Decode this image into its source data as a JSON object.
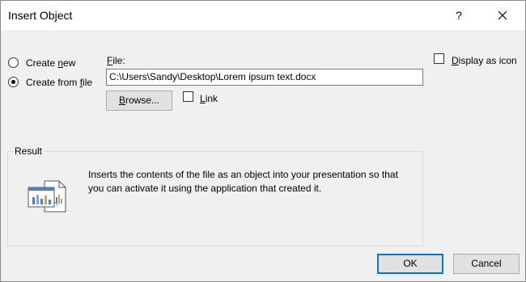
{
  "window": {
    "title": "Insert Object",
    "help_label": "?",
    "close_icon": "close-icon"
  },
  "options": {
    "create_new_prefix": "Create ",
    "create_new_underlined": "n",
    "create_new_suffix": "ew",
    "create_from_file_prefix": "Create from ",
    "create_from_file_underlined": "f",
    "create_from_file_suffix": "ile",
    "selected": "create_from_file"
  },
  "file": {
    "label_underlined": "F",
    "label_rest": "ile:",
    "value": "C:\\Users\\Sandy\\Desktop\\Lorem ipsum text.docx",
    "browse_underlined": "B",
    "browse_rest": "rowse...",
    "link_underlined": "L",
    "link_rest": "ink",
    "link_checked": false
  },
  "display_as_icon": {
    "underlined": "D",
    "rest": "isplay as icon",
    "checked": false
  },
  "result": {
    "legend": "Result",
    "text": "Inserts the contents of the file as an object into your presentation so that you can activate it using the application that created it.",
    "icon": "embedded-object-icon"
  },
  "buttons": {
    "ok": "OK",
    "cancel": "Cancel"
  },
  "colors": {
    "accent": "#0078d7",
    "dialog_bg": "#f0f0f0"
  }
}
